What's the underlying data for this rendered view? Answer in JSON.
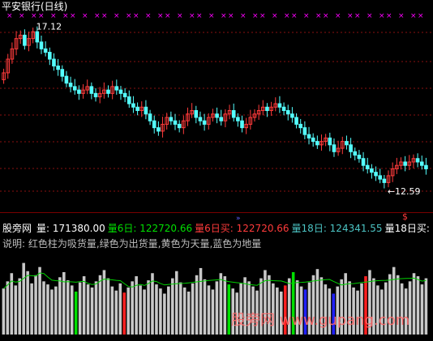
{
  "title": "平安银行(日线)",
  "upper": {
    "high_label": "17.12",
    "low_label": "12.59",
    "marker": "$"
  },
  "legend": [
    {
      "text": "量: 171380.00",
      "color": "#ffffff"
    },
    {
      "text": "量6日: 122720.66",
      "color": "#00e000"
    },
    {
      "text": "量6日买: 122720.66",
      "color": "#ff3b3b"
    },
    {
      "text": "量18日: 124341.55",
      "color": "#4cc4c4"
    },
    {
      "text": "量18日买:",
      "color": "#ffffff"
    }
  ],
  "lower_label": "股旁网",
  "note": "说明: 红色柱为吸货量,绿色为出货量,黄色为天量,蓝色为地量",
  "watermark": "股旁网 www.gupang.com",
  "colors": {
    "up": "#ff3b3b",
    "down": "#54ffff",
    "volume": "#c8c8c8",
    "ma_volume": "#00d000",
    "grid": "#8a1010",
    "signal": "#ff00ff"
  },
  "chart_data": [
    {
      "type": "candlestick",
      "title": "平安银行(日线)",
      "y_range": [
        12.0,
        17.6
      ],
      "annotations": [
        {
          "label": "17.12",
          "value": 17.12
        },
        {
          "label": "12.59",
          "value": 12.59
        }
      ],
      "closes": [
        15.9,
        16.3,
        16.6,
        16.9,
        17.0,
        16.7,
        16.9,
        17.1,
        16.8,
        16.6,
        16.5,
        16.3,
        16.1,
        16.0,
        15.8,
        15.6,
        15.5,
        15.4,
        15.3,
        15.4,
        15.5,
        15.3,
        15.2,
        15.3,
        15.4,
        15.3,
        15.5,
        15.4,
        15.3,
        15.2,
        15.0,
        14.9,
        14.8,
        14.9,
        14.7,
        14.5,
        14.3,
        14.2,
        14.4,
        14.6,
        14.5,
        14.4,
        14.3,
        14.5,
        14.7,
        14.8,
        14.6,
        14.5,
        14.4,
        14.6,
        14.7,
        14.6,
        14.5,
        14.7,
        14.8,
        14.6,
        14.5,
        14.3,
        14.4,
        14.6,
        14.7,
        14.8,
        14.9,
        14.8,
        14.9,
        15.0,
        14.9,
        14.8,
        14.7,
        14.6,
        14.4,
        14.3,
        14.1,
        14.0,
        13.9,
        13.8,
        13.9,
        14.0,
        13.8,
        13.6,
        13.7,
        13.9,
        13.8,
        13.6,
        13.5,
        13.4,
        13.2,
        13.1,
        13.0,
        12.9,
        12.8,
        12.7,
        12.9,
        13.1,
        13.2,
        13.3,
        13.2,
        13.3,
        13.4,
        13.3,
        13.2,
        13.1
      ]
    },
    {
      "type": "bar",
      "title": "股旁网",
      "volumes": [
        45,
        52,
        60,
        48,
        55,
        70,
        62,
        50,
        58,
        66,
        52,
        49,
        44,
        47,
        56,
        61,
        53,
        48,
        42,
        51,
        57,
        49,
        46,
        52,
        58,
        63,
        55,
        47,
        43,
        50,
        41,
        46,
        52,
        57,
        48,
        44,
        53,
        60,
        49,
        45,
        40,
        47,
        55,
        62,
        51,
        46,
        42,
        50,
        58,
        65,
        54,
        48,
        44,
        52,
        60,
        57,
        49,
        45,
        41,
        50,
        56,
        52,
        47,
        43,
        55,
        63,
        58,
        50,
        46,
        42,
        48,
        55,
        61,
        53,
        47,
        44,
        51,
        58,
        64,
        56,
        49,
        45,
        40,
        47,
        54,
        60,
        52,
        46,
        43,
        50,
        57,
        63,
        55,
        48,
        44,
        51,
        59,
        66,
        58,
        50,
        45,
        52,
        60,
        57,
        49,
        55
      ],
      "highlight_red": [
        30,
        70,
        90
      ],
      "highlight_green": [
        18,
        56,
        72
      ],
      "highlight_yellow": [],
      "highlight_blue": [
        75,
        82
      ]
    }
  ]
}
